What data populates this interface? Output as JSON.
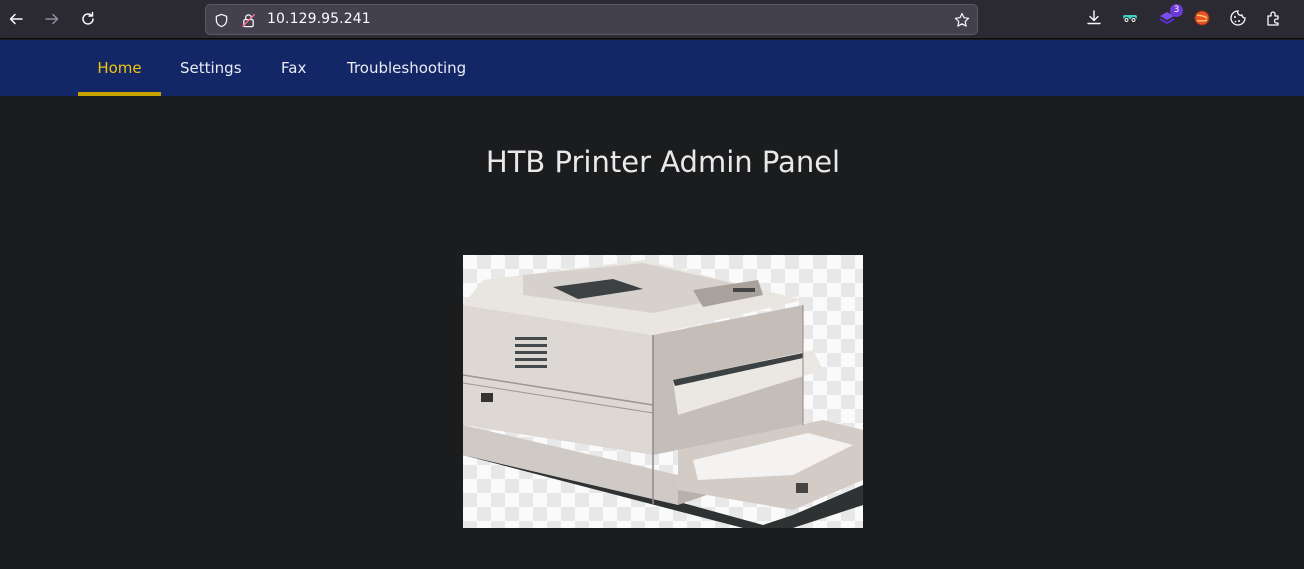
{
  "browser": {
    "url": "10.129.95.241",
    "extension_badge": "3",
    "icons": {
      "back": "back-arrow-icon",
      "forward": "forward-arrow-icon",
      "reload": "reload-icon",
      "shield": "shield-icon",
      "insecure_lock": "insecure-lock-icon",
      "bookmark": "star-icon",
      "downloads": "download-icon",
      "extensions": "puzzle-icon"
    }
  },
  "nav": {
    "items": [
      {
        "label": "Home",
        "active": true
      },
      {
        "label": "Settings",
        "active": false
      },
      {
        "label": "Fax",
        "active": false
      },
      {
        "label": "Troubleshooting",
        "active": false
      }
    ]
  },
  "main": {
    "title": "HTB Printer Admin Panel"
  },
  "colors": {
    "nav_bg": "#132766",
    "active": "#f1c40f",
    "page_bg": "#1b1c1e"
  }
}
